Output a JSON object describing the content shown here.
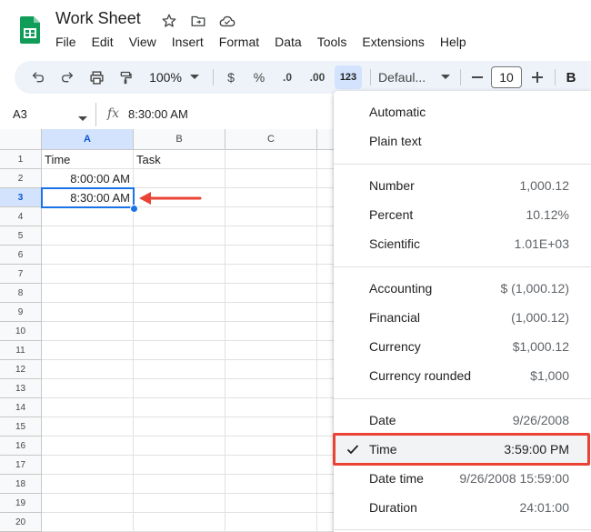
{
  "doc": {
    "title": "Work Sheet"
  },
  "menubar": [
    "File",
    "Edit",
    "View",
    "Insert",
    "Format",
    "Data",
    "Tools",
    "Extensions",
    "Help"
  ],
  "toolbar": {
    "zoom": "100%",
    "currency": "$",
    "percent": "%",
    "dec_decrease": ".0",
    "dec_increase": ".00",
    "format_more": "123",
    "font": "Defaul...",
    "font_size": "10",
    "bold": "B"
  },
  "formula_bar": {
    "cell_ref": "A3",
    "fx": "fx",
    "value": "8:30:00 AM"
  },
  "sheet": {
    "columns": [
      "A",
      "B",
      "C"
    ],
    "rows": [
      "1",
      "2",
      "3",
      "4",
      "5",
      "6",
      "7",
      "8",
      "9",
      "10",
      "11",
      "12",
      "13",
      "14",
      "15",
      "16",
      "17",
      "18",
      "19",
      "20"
    ],
    "cells": {
      "A1": "Time",
      "B1": "Task",
      "A2": "8:00:00 AM",
      "A3": "8:30:00 AM"
    },
    "selected": "A3"
  },
  "format_menu": {
    "groups": [
      [
        {
          "label": "Automatic",
          "example": ""
        },
        {
          "label": "Plain text",
          "example": ""
        }
      ],
      [
        {
          "label": "Number",
          "example": "1,000.12"
        },
        {
          "label": "Percent",
          "example": "10.12%"
        },
        {
          "label": "Scientific",
          "example": "1.01E+03"
        }
      ],
      [
        {
          "label": "Accounting",
          "example": "$ (1,000.12)"
        },
        {
          "label": "Financial",
          "example": "(1,000.12)"
        },
        {
          "label": "Currency",
          "example": "$1,000.12"
        },
        {
          "label": "Currency rounded",
          "example": "$1,000"
        }
      ],
      [
        {
          "label": "Date",
          "example": "9/26/2008"
        },
        {
          "label": "Time",
          "example": "3:59:00 PM",
          "checked": true
        },
        {
          "label": "Date time",
          "example": "9/26/2008 15:59:00"
        },
        {
          "label": "Duration",
          "example": "24:01:00"
        }
      ]
    ]
  },
  "colors": {
    "accent": "#1a73e8",
    "highlight": "#ea4335",
    "selected_header": "#d3e3fd"
  }
}
